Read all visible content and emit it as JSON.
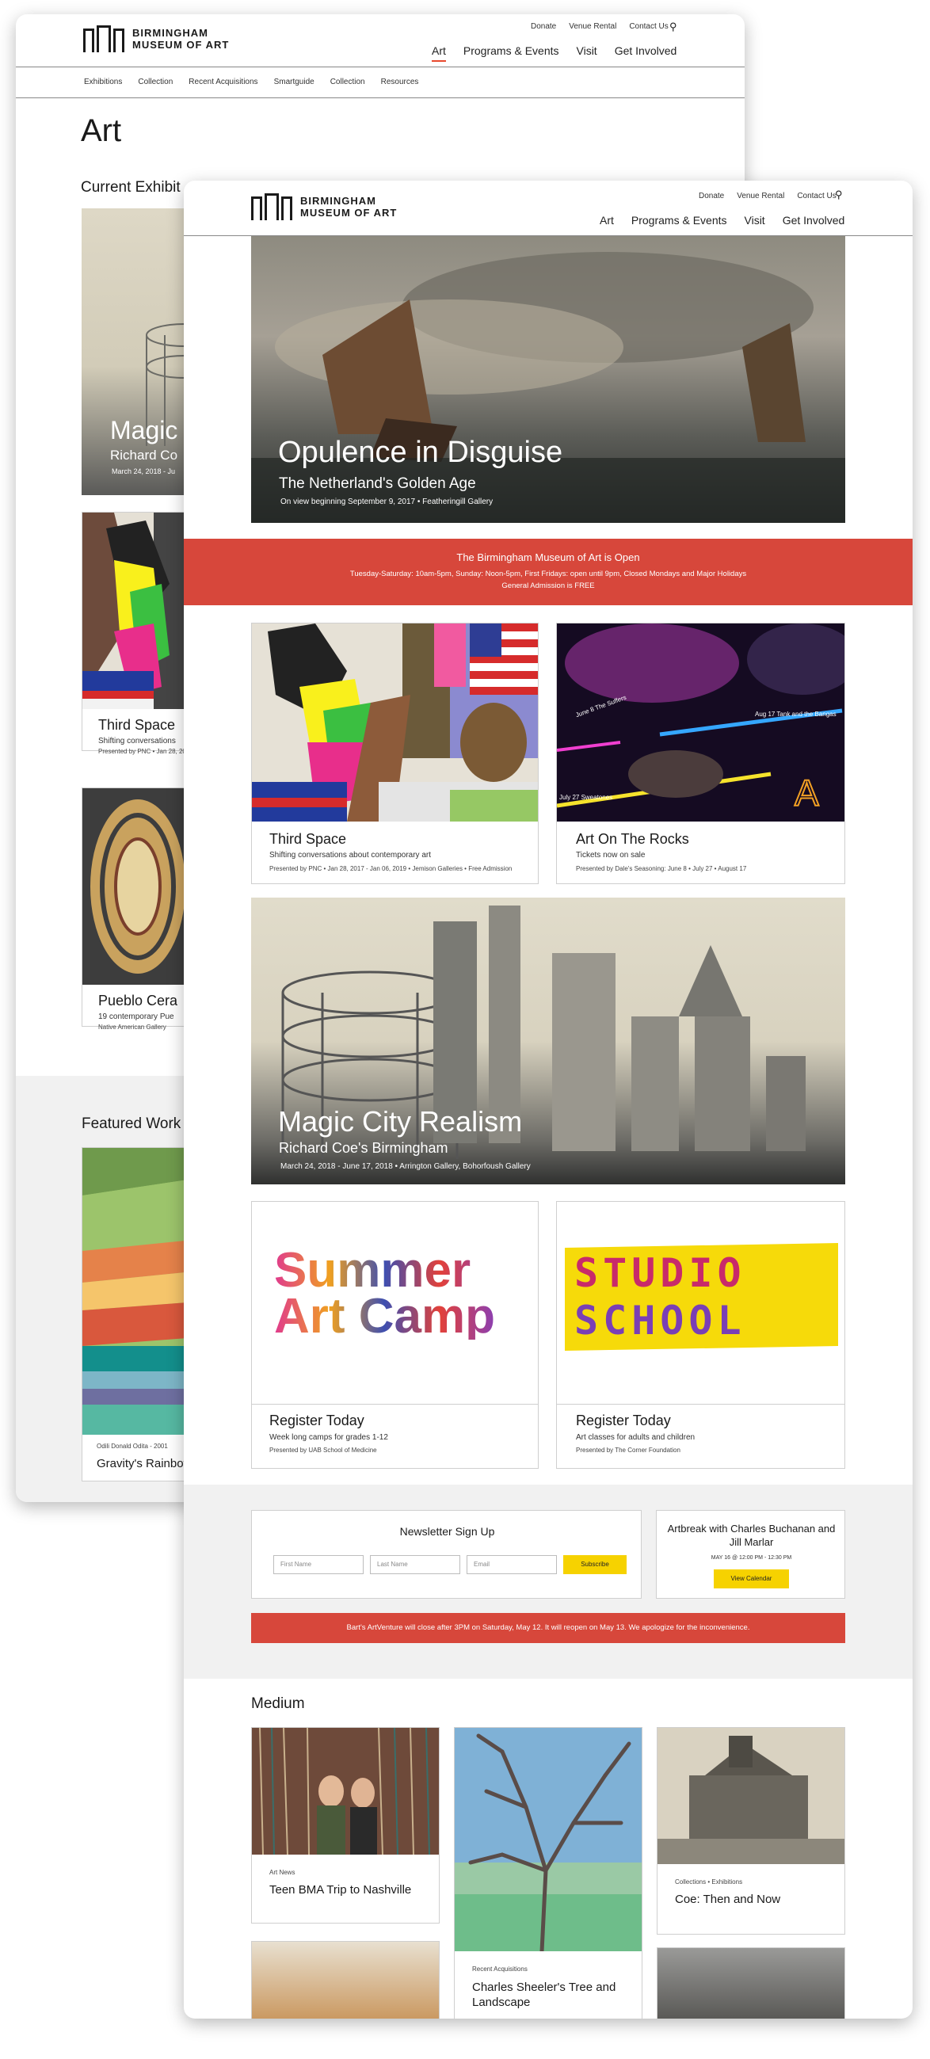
{
  "pageA": {
    "logo": {
      "line1": "BIRMINGHAM",
      "line2": "MUSEUM OF ART"
    },
    "utility_nav": [
      "Donate",
      "Venue Rental",
      "Contact Us"
    ],
    "main_nav": [
      "Art",
      "Programs & Events",
      "Visit",
      "Get Involved"
    ],
    "active_nav": "Art",
    "sub_nav": [
      "Exhibitions",
      "Collection",
      "Recent Acquisitions",
      "Smartguide",
      "Collection",
      "Resources"
    ],
    "page_title": "Art",
    "current_exhibitions_heading": "Current Exhibit",
    "hero_card": {
      "title": "Magic",
      "subtitle": "Richard Co",
      "meta": "March 24, 2018 - Ju"
    },
    "card_third": {
      "title": "Third Space",
      "desc": "Shifting conversations",
      "meta": "Presented by PNC  •  Jan 28, 20"
    },
    "card_pueblo": {
      "title": "Pueblo Cera",
      "desc": "19 contemporary Pue",
      "meta": "Native American Gallery"
    },
    "featured_heading": "Featured Work",
    "featured_card": {
      "meta": "Odili Donald Odita - 2001",
      "title": "Gravity's Rainbow"
    }
  },
  "pageB": {
    "logo": {
      "line1": "BIRMINGHAM",
      "line2": "MUSEUM OF ART"
    },
    "utility_nav": [
      "Donate",
      "Venue Rental",
      "Contact Us"
    ],
    "main_nav": [
      "Art",
      "Programs & Events",
      "Visit",
      "Get Involved"
    ],
    "hero": {
      "title": "Opulence in Disguise",
      "subtitle": "The Netherland's Golden Age",
      "meta": "On view beginning September 9, 2017  •  Featheringill Gallery"
    },
    "open_banner": {
      "title": "The Birmingham Museum of Art is Open",
      "hours": "Tuesday-Saturday: 10am-5pm, Sunday: Noon-5pm, First Fridays: open until 9pm, Closed Mondays and Major Holidays",
      "admission": "General Admission is FREE"
    },
    "card_third": {
      "title": "Third Space",
      "desc": "Shifting conversations about contemporary art",
      "meta": "Presented by PNC  •  Jan 28, 2017 - Jan 06, 2019  •  Jemison Galleries  •  Free Admission"
    },
    "card_rocks": {
      "title": "Art On The Rocks",
      "desc": "Tickets now on sale",
      "meta": "Presented by Dale's Seasoning: June 8  •  July 27  •  August 17",
      "poster_labels": [
        "June 8  The Suffers",
        "Aug 17  Tank and the Bangas",
        "July 27  Sweatones"
      ]
    },
    "magic_city": {
      "title": "Magic City Realism",
      "subtitle": "Richard Coe's Birmingham",
      "meta": "March 24, 2018 - June 17, 2018  •  Arrington Gallery, Bohorfoush Gallery"
    },
    "card_summer": {
      "art_line1": "Summer",
      "art_line2": "Art Camp",
      "title": "Register Today",
      "desc": "Week long camps for grades 1-12",
      "meta": "Presented by UAB School of Medicine"
    },
    "card_studio": {
      "art_line1": "STUDIO",
      "art_line2": "SCHOOL",
      "title": "Register Today",
      "desc": "Art classes for adults and children",
      "meta": "Presented by The Corner Foundation"
    },
    "newsletter": {
      "title": "Newsletter Sign Up",
      "first_placeholder": "First Name",
      "last_placeholder": "Last Name",
      "email_placeholder": "Email",
      "button": "Subscribe"
    },
    "artbreak": {
      "title": "Artbreak with Charles Buchanan and Jill Marlar",
      "meta": "MAY 16 @ 12:00 PM - 12:30 PM",
      "button": "View Calendar"
    },
    "alert": "Bart's ArtVenture will close after 3PM on Saturday, May 12. It will reopen on May 13. We apologize for the inconvenience.",
    "medium_heading": "Medium",
    "medium_cards": [
      {
        "category": "Art News",
        "title": "Teen BMA Trip to Nashville"
      },
      {
        "category": "Recent Acquisitions",
        "title": "Charles Sheeler's Tree and Landscape"
      },
      {
        "category": "Collections  •  Exhibitions",
        "title": "Coe: Then and Now"
      }
    ]
  },
  "colors": {
    "accent_red": "#d7473b",
    "button_yellow": "#f6d200",
    "active_underline": "#e8492e",
    "grey_band": "#f1f1f1"
  },
  "icons": [
    "search-icon",
    "logo-icon"
  ]
}
